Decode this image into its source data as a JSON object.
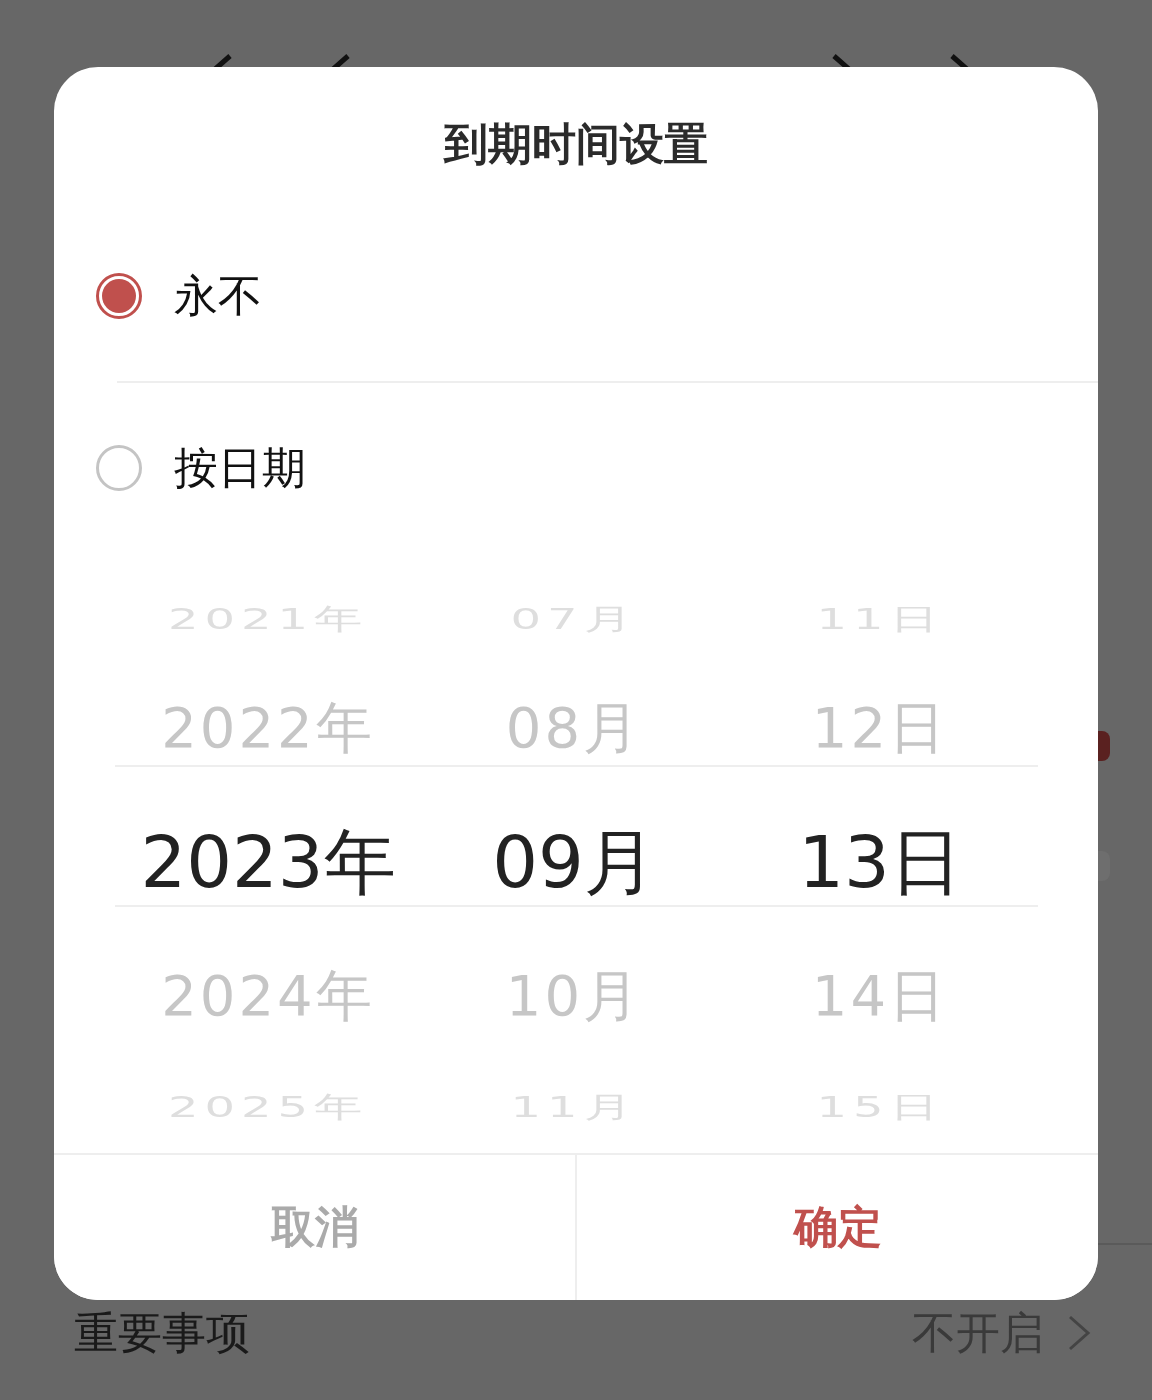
{
  "background": {
    "important_row": {
      "label": "重要事项",
      "value": "不开启"
    }
  },
  "dialog": {
    "title": "到期时间设置",
    "options": [
      {
        "label": "永不",
        "selected": true
      },
      {
        "label": "按日期",
        "selected": false
      }
    ],
    "picker": {
      "columns": [
        {
          "items": [
            {
              "text": "2021年",
              "selected": false
            },
            {
              "text": "2022年",
              "selected": false
            },
            {
              "text": "2023年",
              "selected": true
            },
            {
              "text": "2024年",
              "selected": false
            },
            {
              "text": "2025年",
              "selected": false
            }
          ]
        },
        {
          "items": [
            {
              "text": "07月",
              "selected": false
            },
            {
              "text": "08月",
              "selected": false
            },
            {
              "text": "09月",
              "selected": true
            },
            {
              "text": "10月",
              "selected": false
            },
            {
              "text": "11月",
              "selected": false
            }
          ]
        },
        {
          "items": [
            {
              "text": "11日",
              "selected": false
            },
            {
              "text": "12日",
              "selected": false
            },
            {
              "text": "13日",
              "selected": true
            },
            {
              "text": "14日",
              "selected": false
            },
            {
              "text": "15日",
              "selected": false
            }
          ]
        }
      ]
    },
    "buttons": [
      {
        "label": "取消",
        "kind": "cancel"
      },
      {
        "label": "确定",
        "kind": "confirm"
      }
    ]
  }
}
